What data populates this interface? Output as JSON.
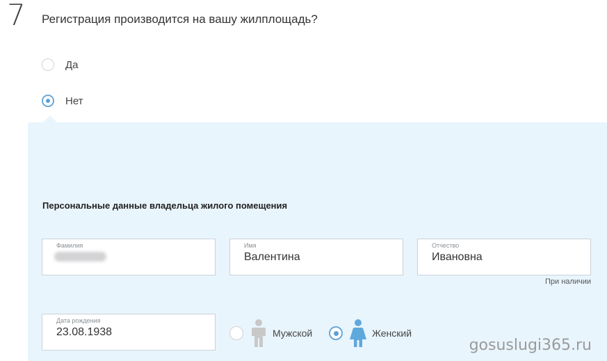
{
  "step": {
    "number": "7",
    "question": "Регистрация производится на вашу жилплощадь?"
  },
  "options": [
    {
      "label": "Да",
      "checked": false
    },
    {
      "label": "Нет",
      "checked": true
    }
  ],
  "owner": {
    "section_title": "Персональные данные владельца жилого помещения",
    "surname": {
      "label": "Фамилия",
      "value": ""
    },
    "name": {
      "label": "Имя",
      "value": "Валентина"
    },
    "patronymic": {
      "label": "Отчество",
      "value": "Ивановна",
      "hint": "При наличии"
    },
    "birthdate": {
      "label": "Дата рождения",
      "value": "23.08.1938"
    },
    "gender": {
      "male": {
        "label": "Мужской",
        "checked": false,
        "icon": "male-person-icon"
      },
      "female": {
        "label": "Женский",
        "checked": true,
        "icon": "female-person-icon"
      }
    }
  },
  "watermark": "gosuslugi365.ru",
  "colors": {
    "panel": "#e9f5fd",
    "accent": "#5d9fd4",
    "male_icon": "#c8c8c8",
    "female_icon": "#5fa8dc"
  }
}
